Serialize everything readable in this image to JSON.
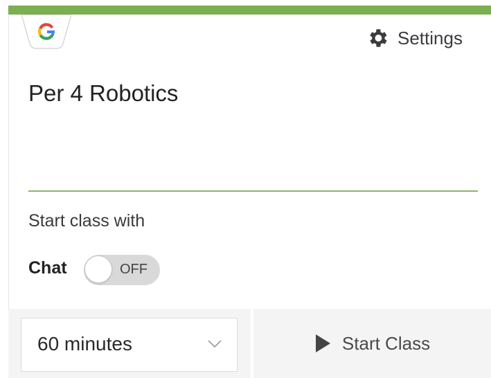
{
  "header": {
    "google_logo_icon": "google-g-icon",
    "settings_label": "Settings",
    "settings_icon": "gear-icon",
    "accent_color": "#7cae52"
  },
  "class_card": {
    "title": "Per 4 Robotics",
    "start_with_label": "Start class with",
    "chat": {
      "label": "Chat",
      "toggle_state": "OFF"
    }
  },
  "footer": {
    "duration": {
      "selected": "60 minutes",
      "icon": "chevron-down-icon"
    },
    "start_class": {
      "label": "Start Class",
      "icon": "play-icon"
    }
  }
}
